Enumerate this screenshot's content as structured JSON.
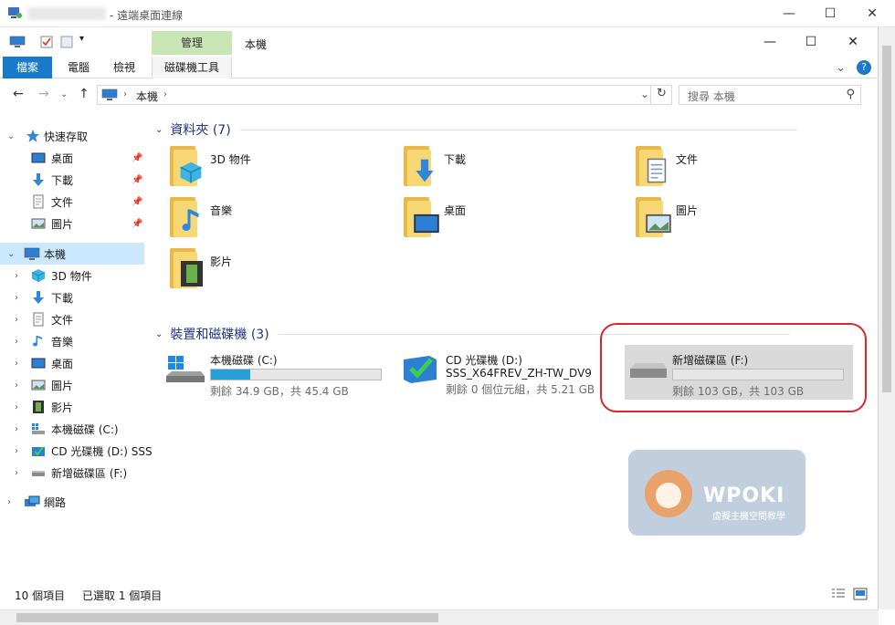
{
  "remote": {
    "title": "- 遠端桌面連線",
    "minimize": "—",
    "maximize": "☐",
    "close": "✕"
  },
  "window": {
    "context_tab": "管理",
    "title": "本機",
    "minimize": "—",
    "maximize": "☐",
    "close": "✕"
  },
  "ribbon": {
    "tabs": [
      "檔案",
      "電腦",
      "檢視",
      "磁碟機工具"
    ],
    "expand": "⌄",
    "help": "?"
  },
  "address": {
    "back": "←",
    "forward": "→",
    "recent": "⌄",
    "up": "↑",
    "crumb": "本機",
    "refresh": "↻",
    "dropdown": "⌄",
    "search_placeholder": "搜尋 本機",
    "search_icon": "⚲"
  },
  "nav": {
    "quick_access": "快速存取",
    "quick_items": [
      "桌面",
      "下載",
      "文件",
      "圖片"
    ],
    "this_pc": "本機",
    "pc_items": [
      "3D 物件",
      "下載",
      "文件",
      "音樂",
      "桌面",
      "圖片",
      "影片",
      "本機磁碟 (C:)",
      "CD 光碟機 (D:) SSS",
      "新增磁碟區 (F:)"
    ],
    "network": "網路"
  },
  "content": {
    "folders_group": "資料夾 (7)",
    "folders": [
      "3D 物件",
      "下載",
      "文件",
      "音樂",
      "桌面",
      "圖片",
      "影片"
    ],
    "drives_group": "裝置和磁碟機 (3)",
    "drives": [
      {
        "name": "本機磁碟 (C:)",
        "free": "剩餘 34.9 GB，共 45.4 GB",
        "used_fraction": 0.23
      },
      {
        "name": "CD 光碟機 (D:)",
        "label": "SSS_X64FREV_ZH-TW_DV9",
        "free": "剩餘 0 個位元組，共 5.21 GB"
      },
      {
        "name": "新增磁碟區 (F:)",
        "free": "剩餘 103 GB，共 103 GB",
        "used_fraction": 0.0
      }
    ]
  },
  "watermark": {
    "brand": "WPOKI",
    "tagline": "虛擬主機空間教學"
  },
  "status": {
    "count": "10 個項目",
    "selected": "已選取 1 個項目"
  },
  "colors": {
    "accent": "#1979ca",
    "context_tab": "#c8e6b4",
    "selection": "#cce8ff",
    "group_title": "#1e3287",
    "bar_fill": "#26a0da",
    "highlight_ring": "#d8262a"
  }
}
